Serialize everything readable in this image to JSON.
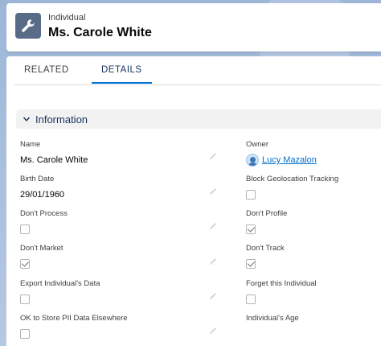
{
  "header": {
    "object_label": "Individual",
    "record_title": "Ms. Carole White",
    "icon": "wrench-icon"
  },
  "tabs": [
    {
      "label": "RELATED",
      "active": false
    },
    {
      "label": "DETAILS",
      "active": true
    }
  ],
  "section": {
    "title": "Information",
    "icon": "chevron-down-icon"
  },
  "fields": {
    "name": {
      "label": "Name",
      "value": "Ms. Carole White"
    },
    "owner": {
      "label": "Owner",
      "value": "Lucy Mazalon"
    },
    "birth_date": {
      "label": "Birth Date",
      "value": "29/01/1960"
    },
    "block_geolocation": {
      "label": "Block Geolocation Tracking",
      "checked": false
    },
    "dont_process": {
      "label": "Don't Process",
      "checked": false
    },
    "dont_profile": {
      "label": "Don't Profile",
      "checked": true
    },
    "dont_market": {
      "label": "Don't Market",
      "checked": true
    },
    "dont_track": {
      "label": "Don't Track",
      "checked": true
    },
    "export_data": {
      "label": "Export Individual's Data",
      "checked": false
    },
    "forget_individual": {
      "label": "Forget this Individual",
      "checked": false
    },
    "ok_store_pii": {
      "label": "OK to Store PII Data Elsewhere",
      "checked": false
    },
    "individual_age": {
      "label": "Individual's Age",
      "value": ""
    }
  },
  "colors": {
    "accent": "#0070d2",
    "link": "#006dcc",
    "header_icon_bg": "#5a6b88",
    "section_bg": "#f3f2f2"
  }
}
